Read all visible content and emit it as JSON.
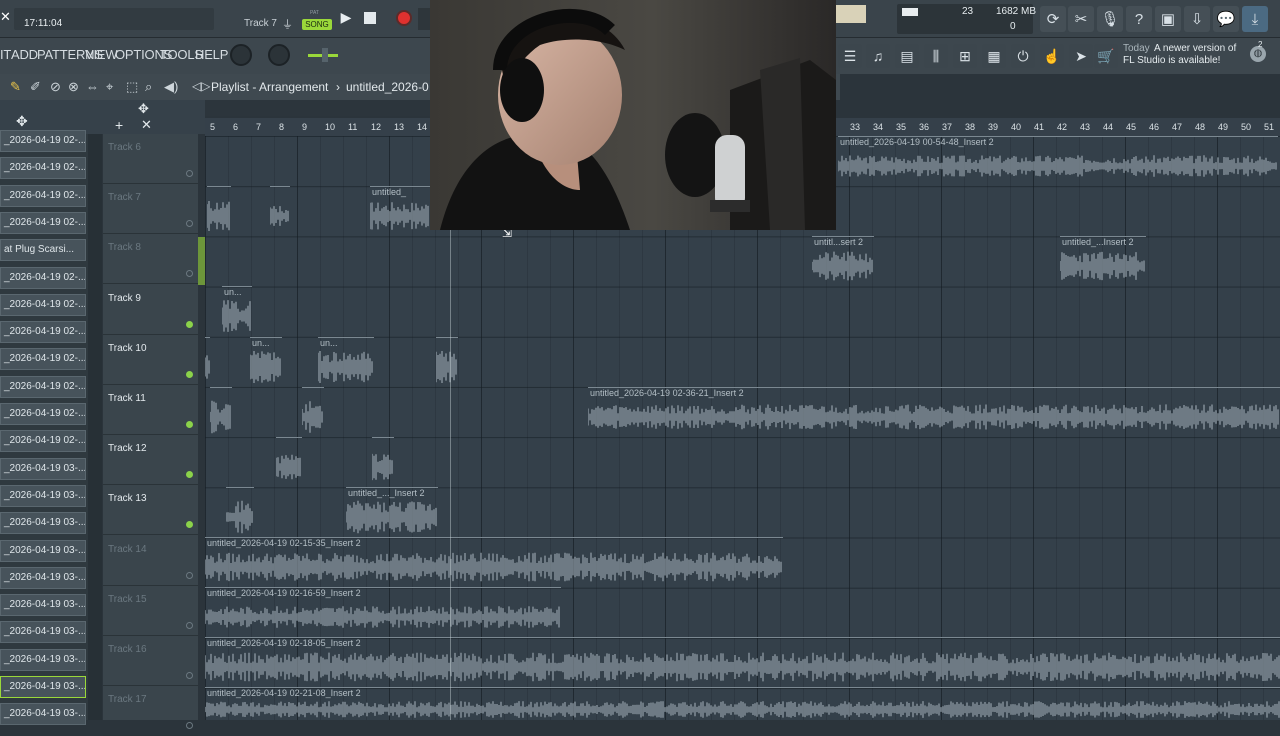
{
  "topbar": {
    "time": "17:11:04",
    "hint": "Track 7",
    "pattern_label": "PAT",
    "song_label": "SONG",
    "cpu": "23",
    "memory": "1682 MB",
    "voices": "0"
  },
  "menu": [
    "IT",
    "ADD",
    "PATTERNS",
    "VIEW",
    "OPTIONS",
    "TOOLS",
    "HELP"
  ],
  "news": {
    "date": "Today",
    "line1": "A newer version of",
    "line2": "FL Studio is available!",
    "badge": "2"
  },
  "playlist": {
    "title": "Playlist - Arrangement",
    "separator": "›",
    "name": "untitled_2026-0",
    "bars_left": [
      "5",
      "6",
      "7",
      "8",
      "9",
      "10",
      "11",
      "12",
      "13",
      "14"
    ],
    "bars_right": [
      "33",
      "34",
      "35",
      "36",
      "37",
      "38",
      "39",
      "40",
      "41",
      "42",
      "43",
      "44",
      "45",
      "46",
      "47",
      "48",
      "49",
      "50",
      "51"
    ]
  },
  "patterns": [
    "_2026-04-19 02-...",
    "_2026-04-19 02-...",
    "_2026-04-19 02-...",
    "_2026-04-19 02-...",
    "at Plug Scarsi...",
    "_2026-04-19 02-...",
    "_2026-04-19 02-...",
    "_2026-04-19 02-...",
    "_2026-04-19 02-...",
    "_2026-04-19 02-...",
    "_2026-04-19 02-...",
    "_2026-04-19 02-...",
    "_2026-04-19 03-...",
    "_2026-04-19 03-...",
    "_2026-04-19 03-...",
    "_2026-04-19 03-...",
    "_2026-04-19 03-...",
    "_2026-04-19 03-...",
    "_2026-04-19 03-...",
    "_2026-04-19 03-...",
    "_2026-04-19 03-...",
    "_2026-04-19 03-..."
  ],
  "tracks": [
    {
      "name": "Track 6",
      "active": false
    },
    {
      "name": "Track 7",
      "active": false
    },
    {
      "name": "Track 8",
      "active": false
    },
    {
      "name": "Track 9",
      "active": true
    },
    {
      "name": "Track 10",
      "active": true
    },
    {
      "name": "Track 11",
      "active": true
    },
    {
      "name": "Track 12",
      "active": true
    },
    {
      "name": "Track 13",
      "active": true
    },
    {
      "name": "Track 14",
      "active": false
    },
    {
      "name": "Track 15",
      "active": false
    },
    {
      "name": "Track 16",
      "active": false
    },
    {
      "name": "Track 17",
      "active": false
    }
  ],
  "clips": {
    "t6": "untitled_2026-04-19 00-54-48_Insert 2",
    "t7": "untitled_",
    "t8a": "untitl...sert 2",
    "t8b": "untitled_...Insert 2",
    "t9": "un...",
    "t10": "un...",
    "t11": "untitled_2026-04-19 02-36-21_Insert 2",
    "t13": "untitled_..._Insert 2",
    "t14": "untitled_2026-04-19 02-15-35_Insert 2",
    "t15": "untitled_2026-04-19 02-16-59_Insert 2",
    "t16": "untitled_2026-04-19 02-18-05_Insert 2",
    "t17": "untitled_2026-04-19 02-21-08_Insert 2"
  },
  "colors": {
    "active_led": "#8bd24a",
    "record": "#e0312f",
    "song_badge": "#9ad83a"
  }
}
